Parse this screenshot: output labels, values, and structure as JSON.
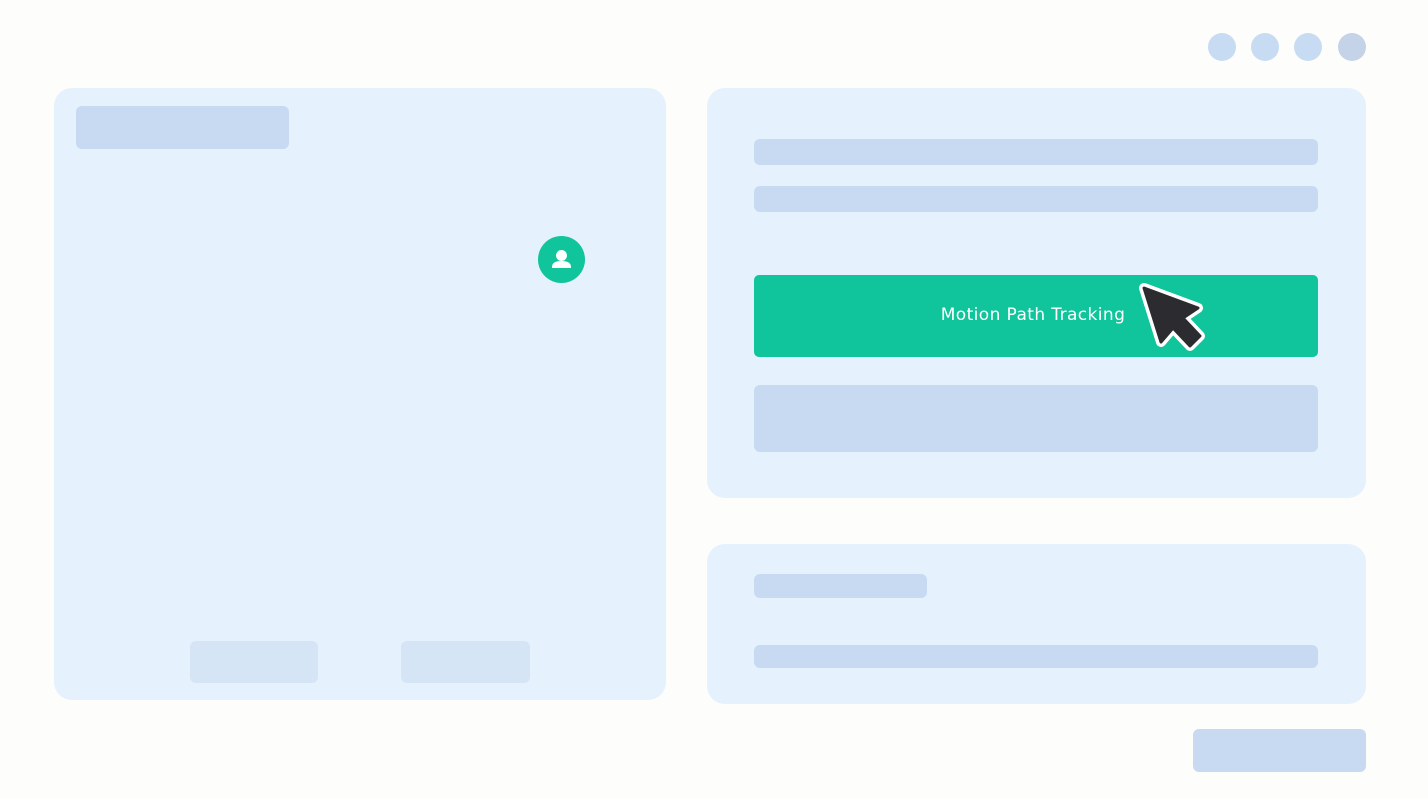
{
  "window_controls": {
    "icons": [
      "circle-icon",
      "circle-icon",
      "circle-icon",
      "circle-icon"
    ]
  },
  "left_panel": {
    "avatar_icon": "user-icon",
    "avatar_color": "#10c49b"
  },
  "right_panel": {
    "primary_button": {
      "label": "Motion Path Tracking",
      "color": "#10c49b"
    },
    "cursor_icon": "mouse-pointer-icon"
  },
  "colors": {
    "background": "#fdfdfc",
    "panel": "#e5f1fc",
    "placeholder": "#c7daf2"
  }
}
